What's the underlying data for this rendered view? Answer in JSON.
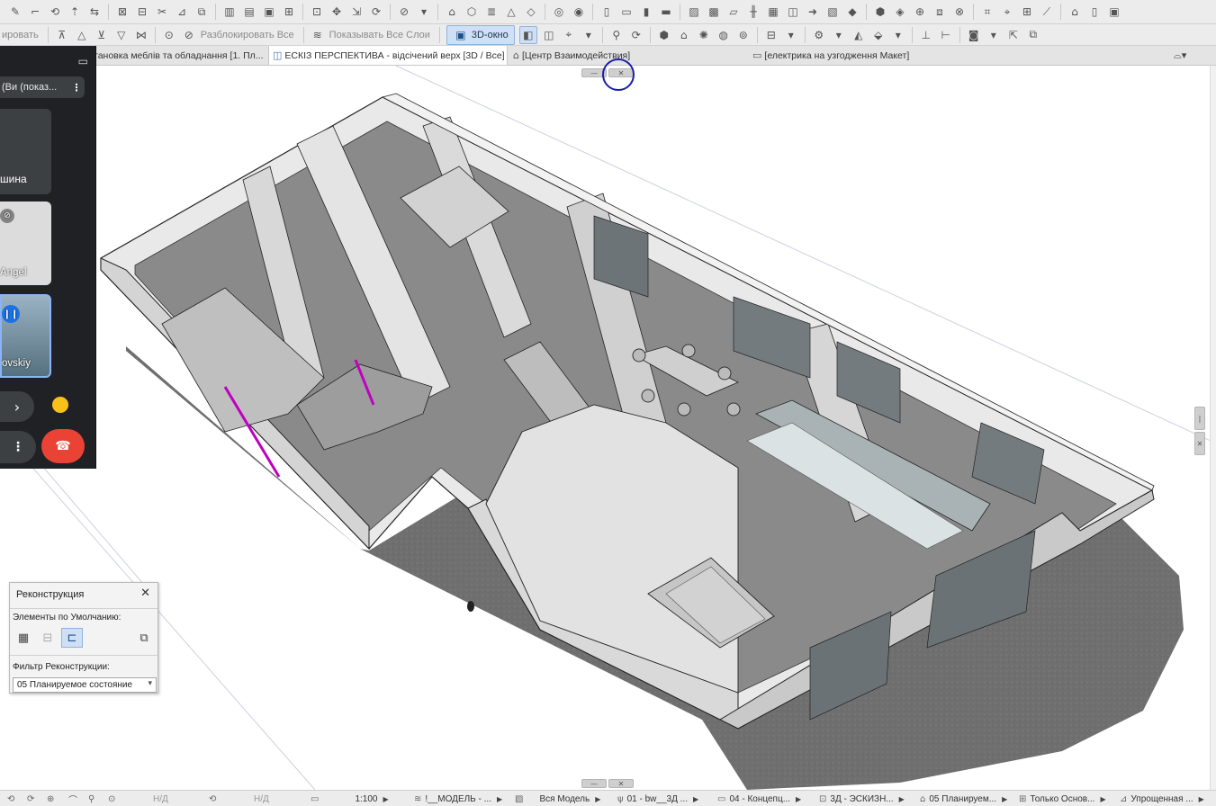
{
  "toolbar": {
    "unlock_all": "Разблокировать Все",
    "show_all_layers": "Показывать Все Слои",
    "cut_left_text": "ировать",
    "btn_3d": "3D-окно"
  },
  "tabs": [
    {
      "label": "тановка меблів та обладнання [1. Пл...",
      "icon": "floor-plan-icon"
    },
    {
      "label": "ЕСКІЗ ПЕРСПЕКТИВА - відсічений верх [3D / Все]",
      "icon": "3d-view-icon",
      "close": "✖"
    },
    {
      "label": "[Центр Взаимодействия]",
      "icon": "collab-center-icon"
    },
    {
      "label": "[електрика на узгодження Макет]",
      "icon": "layout-icon"
    }
  ],
  "call": {
    "self_label": "(Ви (показ...",
    "tile1_name": "шина",
    "tile2_name": "Angel",
    "tile3_name": "ovskiy"
  },
  "renovation": {
    "title": "Реконструкция",
    "close": "✕",
    "defaults_label": "Элементы по Умолчанию:",
    "filter_label": "Фильтр Реконструкции:",
    "filter_value": "05 Планируемое состояние"
  },
  "status": {
    "nd1": "Н/Д",
    "nd2": "Н/Д",
    "scale": "1:100",
    "layer_combo": "!__МОДЕЛЬ - ...",
    "model": "Вся Модель",
    "pen_set": "01 - bw__3Д ...",
    "model_view": "04 - Концепц...",
    "view_3d": "3Д - ЭСКИЗН...",
    "reno_filter": "05 Планируем...",
    "structure": "Только Основ...",
    "simplified": "Упрощенная ..."
  },
  "colors": {
    "toolbar_bg": "#ececec",
    "accent": "#cfe0f4",
    "call_bg": "#202124",
    "end_call": "#ea4335"
  }
}
